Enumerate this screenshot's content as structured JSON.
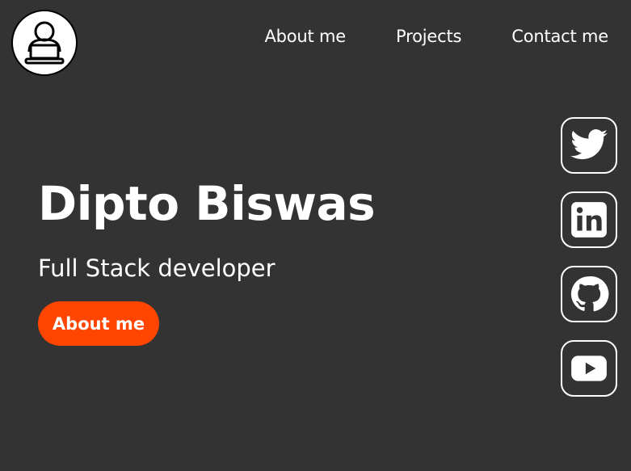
{
  "header": {
    "logo_icon": "person-at-laptop-icon",
    "nav": [
      {
        "label": "About me"
      },
      {
        "label": "Projects"
      },
      {
        "label": "Contact me"
      }
    ]
  },
  "hero": {
    "name": "Dipto Biswas",
    "subtitle": "Full Stack developer",
    "cta_label": "About me"
  },
  "social": [
    {
      "icon": "twitter-icon"
    },
    {
      "icon": "linkedin-icon"
    },
    {
      "icon": "github-icon"
    },
    {
      "icon": "youtube-icon"
    }
  ],
  "colors": {
    "background": "#333333",
    "accent": "#ff4500",
    "text": "#ffffff"
  }
}
